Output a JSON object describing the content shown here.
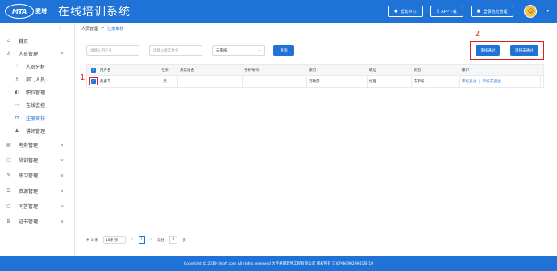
{
  "header": {
    "logo_text": "MTA",
    "logo_sub": "麦塔",
    "title": "在线培训系统",
    "actions": [
      {
        "label": "帮助中心",
        "icon": "help-icon"
      },
      {
        "label": "APP下载",
        "icon": "phone-icon"
      },
      {
        "label": "登录地址管理",
        "icon": "manage-icon"
      }
    ]
  },
  "sidebar": {
    "items": [
      {
        "label": "首页",
        "icon": "home-icon"
      },
      {
        "label": "人员管理",
        "icon": "person-icon",
        "arrow": "up"
      },
      {
        "label": "人员分析",
        "icon": "analysis-icon"
      },
      {
        "label": "部门人员",
        "icon": "department-icon"
      },
      {
        "label": "职位管理",
        "icon": "position-icon"
      },
      {
        "label": "在线监控",
        "icon": "monitor-icon"
      },
      {
        "label": "注册审核",
        "icon": "review-icon"
      },
      {
        "label": "讲师管理",
        "icon": "lecturer-icon"
      },
      {
        "label": "考务管理",
        "icon": "exam-icon",
        "arrow": "down"
      },
      {
        "label": "培训管理",
        "icon": "training-icon",
        "arrow": "down"
      },
      {
        "label": "练习管理",
        "icon": "practice-icon",
        "arrow": "down"
      },
      {
        "label": "资源管理",
        "icon": "resource-icon",
        "arrow": "down"
      },
      {
        "label": "问答管理",
        "icon": "qa-icon",
        "arrow": "down"
      },
      {
        "label": "证书管理",
        "icon": "certificate-icon",
        "arrow": "down"
      }
    ]
  },
  "breadcrumb": {
    "root": "人员管理",
    "sep": ">",
    "current": "注册审核"
  },
  "filters": {
    "account_placeholder": "请输入用户名",
    "name_placeholder": "请输入真实姓名",
    "status_value": "未审核",
    "query_label": "查询"
  },
  "bulk": {
    "approve_label": "审核通过",
    "reject_label": "审核未通过"
  },
  "annotations": {
    "one": "1",
    "two": "2"
  },
  "table": {
    "headers": [
      "用户名",
      "性别",
      "真实姓名",
      "手机号码",
      "部门",
      "职位",
      "状态",
      "操作"
    ],
    "rows": [
      {
        "username": "赵喜平",
        "gender": "男",
        "realname": "",
        "phone": "",
        "dept": "行政部",
        "position": "经理",
        "status": "未审核",
        "approve": "审核通过",
        "sep": "|",
        "reject": "审核未通过"
      }
    ]
  },
  "pager": {
    "total": "共 1 条",
    "page_size": "10条/页",
    "prev": "<",
    "current": "1",
    "next": ">",
    "goto_label": "前往",
    "goto_value": "1",
    "page_unit": "页"
  },
  "footer": {
    "text": "Copyright © 2019 lllsoft.com All rights reserved 大连格网软件工程有限公司 版权所有 辽ICP备09029941号-19"
  },
  "colors": {
    "primary": "#1f73d6",
    "annotation": "#e02020"
  }
}
